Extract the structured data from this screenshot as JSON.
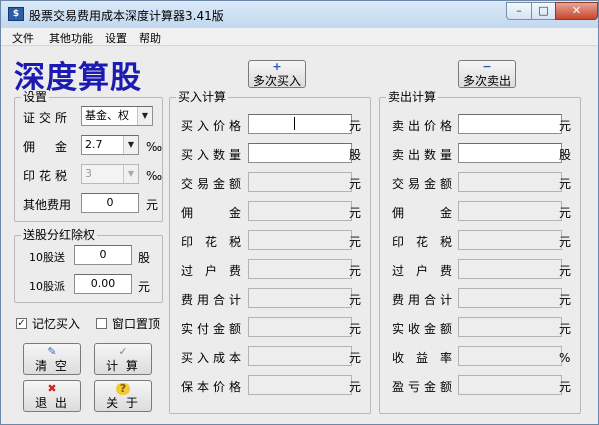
{
  "window": {
    "title": "股票交易费用成本深度计算器3.41版",
    "min_icon": "minimize-icon",
    "max_icon": "maximize-icon",
    "close_icon": "close-icon",
    "min_glyph": "–",
    "max_glyph": "□",
    "close_glyph": "✕"
  },
  "menu": [
    "文件",
    "其他功能",
    "设置",
    "帮助"
  ],
  "logo": "深度算股",
  "settings": {
    "title": "设置",
    "exchange_label": "证交所",
    "exchange_value": "基金、权",
    "commission_label": "佣金",
    "commission_value": "2.7",
    "commission_unit": "‰",
    "stamp_label": "印花税",
    "stamp_value": "3",
    "stamp_unit": "‰",
    "other_label": "其他费用",
    "other_value": "0",
    "other_unit": "元"
  },
  "dividend": {
    "title": "送股分红除权",
    "bonus_label": "10股送",
    "bonus_value": "0",
    "bonus_unit": "股",
    "cash_label": "10股派",
    "cash_value": "0.00",
    "cash_unit": "元"
  },
  "options": {
    "remember_label": "记忆买入",
    "remember_checked": true,
    "check_glyph": "✓",
    "topmost_label": "窗口置顶",
    "topmost_checked": false
  },
  "buttons": {
    "clear": "清 空",
    "clear_icon": "eraser-icon",
    "clear_glyph": "✎",
    "calc": "计 算",
    "calc_icon": "checkmark-icon",
    "calc_glyph": "✓",
    "exit": "退 出",
    "exit_icon": "red-x-icon",
    "exit_glyph": "✖",
    "about": "关 于",
    "about_icon": "help-icon",
    "about_glyph": "?",
    "multi_buy": "多次买入",
    "multi_buy_icon": "plus-icon",
    "multi_buy_glyph": "+",
    "multi_sell": "多次卖出",
    "multi_sell_icon": "minus-icon",
    "multi_sell_glyph": "−",
    "dropdown_glyph": "▼"
  },
  "buy": {
    "title": "买入计算",
    "rows": [
      {
        "label": "买入价格",
        "value": "",
        "unit": "元"
      },
      {
        "label": "买入数量",
        "value": "",
        "unit": "股"
      },
      {
        "label": "交易金额",
        "value": "",
        "unit": "元"
      },
      {
        "label": "佣金",
        "value": "",
        "unit": "元"
      },
      {
        "label": "印花税",
        "value": "",
        "unit": "元"
      },
      {
        "label": "过户费",
        "value": "",
        "unit": "元"
      },
      {
        "label": "费用合计",
        "value": "",
        "unit": "元"
      },
      {
        "label": "实付金额",
        "value": "",
        "unit": "元"
      },
      {
        "label": "买入成本",
        "value": "",
        "unit": "元"
      },
      {
        "label": "保本价格",
        "value": "",
        "unit": "元"
      }
    ]
  },
  "sell": {
    "title": "卖出计算",
    "rows": [
      {
        "label": "卖出价格",
        "value": "",
        "unit": "元"
      },
      {
        "label": "卖出数量",
        "value": "",
        "unit": "股"
      },
      {
        "label": "交易金额",
        "value": "",
        "unit": "元"
      },
      {
        "label": "佣金",
        "value": "",
        "unit": "元"
      },
      {
        "label": "印花税",
        "value": "",
        "unit": "元"
      },
      {
        "label": "过户费",
        "value": "",
        "unit": "元"
      },
      {
        "label": "费用合计",
        "value": "",
        "unit": "元"
      },
      {
        "label": "实收金额",
        "value": "",
        "unit": "元"
      },
      {
        "label": "收益率",
        "value": "",
        "unit": "%"
      },
      {
        "label": "盈亏金额",
        "value": "",
        "unit": "元"
      }
    ]
  }
}
